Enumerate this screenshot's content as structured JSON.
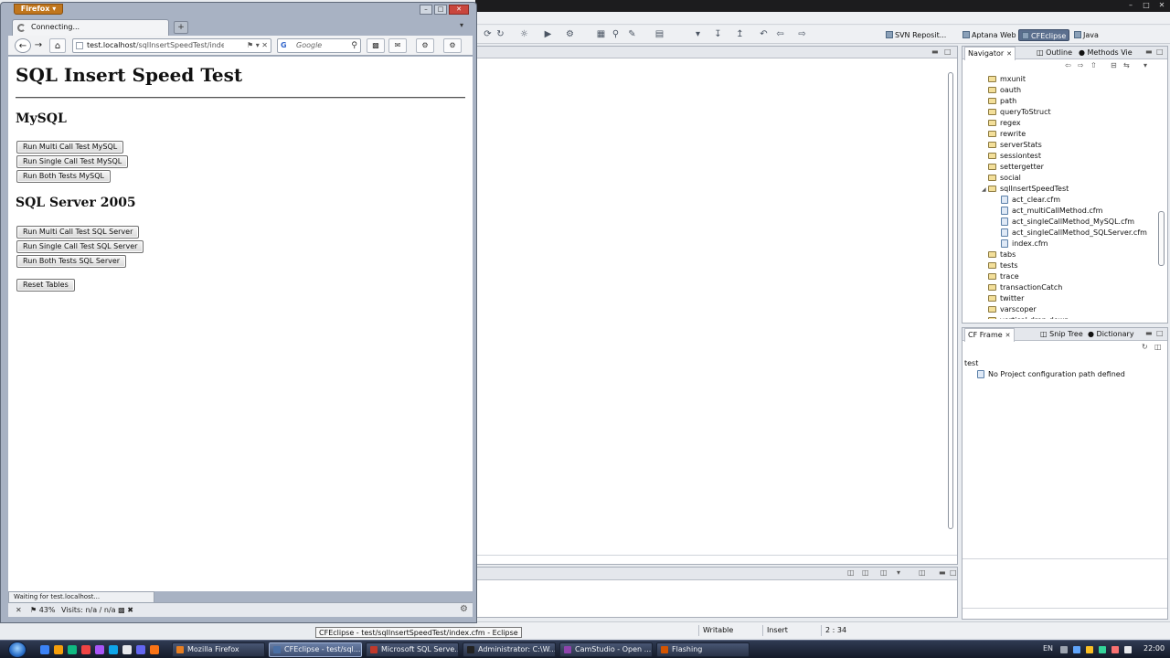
{
  "firefox": {
    "menu_button": "Firefox",
    "tab_title": "Connecting...",
    "url_host": "test.localhost",
    "url_path": "/sqlInsertSpeedTest/index.",
    "search_placeholder": "Google",
    "search_engine_glyph": "G",
    "status_tip": "Waiting for test.localhost...",
    "addon_percent": "43%",
    "addon_visits": "Visits: n/a / n/a"
  },
  "page": {
    "title": "SQL Insert Speed Test",
    "mysql_heading": "MySQL",
    "mysql_buttons": [
      "Run Multi Call Test MySQL",
      "Run Single Call Test MySQL",
      "Run Both Tests MySQL"
    ],
    "sqlserver_heading": "SQL Server 2005",
    "sqlserver_buttons": [
      "Run Multi Call Test SQL Server",
      "Run Single Call Test SQL Server",
      "Run Both Tests SQL Server"
    ],
    "reset_button": "Reset Tables"
  },
  "eclipse": {
    "perspectives": [
      "SVN Reposit...",
      "Aptana Web",
      "CFEclipse",
      "Java"
    ],
    "active_perspective": "CFEclipse",
    "navigator_tabs": [
      "Navigator",
      "Outline",
      "Methods Vie"
    ],
    "navigator_items": [
      {
        "label": "mxunit",
        "kind": "folder",
        "depth": 0
      },
      {
        "label": "oauth",
        "kind": "folder",
        "depth": 0
      },
      {
        "label": "path",
        "kind": "folder",
        "depth": 0
      },
      {
        "label": "queryToStruct",
        "kind": "folder",
        "depth": 0
      },
      {
        "label": "regex",
        "kind": "folder",
        "depth": 0
      },
      {
        "label": "rewrite",
        "kind": "folder",
        "depth": 0
      },
      {
        "label": "serverStats",
        "kind": "folder",
        "depth": 0
      },
      {
        "label": "sessiontest",
        "kind": "folder",
        "depth": 0
      },
      {
        "label": "settergetter",
        "kind": "folder",
        "depth": 0
      },
      {
        "label": "social",
        "kind": "folder",
        "depth": 0
      },
      {
        "label": "sqlInsertSpeedTest",
        "kind": "folder",
        "depth": 0,
        "expanded": true
      },
      {
        "label": "act_clear.cfm",
        "kind": "file",
        "depth": 1
      },
      {
        "label": "act_multiCallMethod.cfm",
        "kind": "file",
        "depth": 1
      },
      {
        "label": "act_singleCallMethod_MySQL.cfm",
        "kind": "file",
        "depth": 1
      },
      {
        "label": "act_singleCallMethod_SQLServer.cfm",
        "kind": "file",
        "depth": 1
      },
      {
        "label": "index.cfm",
        "kind": "file",
        "depth": 1
      },
      {
        "label": "tabs",
        "kind": "folder",
        "depth": 0
      },
      {
        "label": "tests",
        "kind": "folder",
        "depth": 0
      },
      {
        "label": "trace",
        "kind": "folder",
        "depth": 0
      },
      {
        "label": "transactionCatch",
        "kind": "folder",
        "depth": 0
      },
      {
        "label": "twitter",
        "kind": "folder",
        "depth": 0
      },
      {
        "label": "varscoper",
        "kind": "folder",
        "depth": 0
      },
      {
        "label": "vertical-drop-down",
        "kind": "folder",
        "depth": 0
      }
    ],
    "cfframe_tabs": [
      "CF Frame",
      "Snip Tree",
      "Dictionary"
    ],
    "cfframe_project": "test",
    "cfframe_message": "No Project configuration path defined",
    "status": {
      "writable": "Writable",
      "insert": "Insert",
      "position": "2 : 34"
    }
  },
  "taskbar": {
    "tooltip": "CFEclipse - test/sqlInsertSpeedTest/index.cfm - Eclipse",
    "items": [
      "Mozilla Firefox",
      "CFEclipse - test/sql...",
      "Microsoft SQL Serve...",
      "Administrator: C:\\W...",
      "CamStudio - Open ...",
      "Flashing"
    ],
    "active_index": 1,
    "language": "EN",
    "clock": "22:00"
  }
}
